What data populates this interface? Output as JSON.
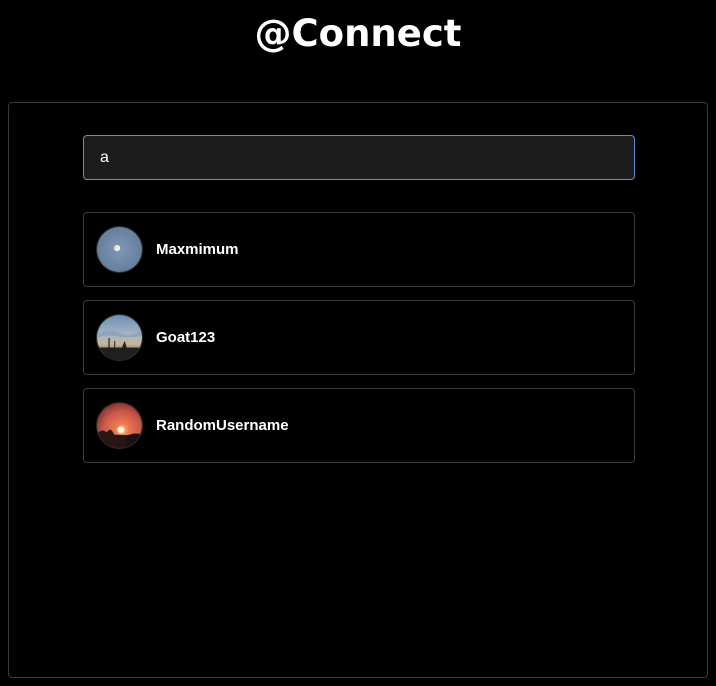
{
  "header": {
    "title": "@Connect"
  },
  "search": {
    "value": "a",
    "placeholder": ""
  },
  "results": [
    {
      "username": "Maxmimum",
      "avatar": "avatar-moon-sky"
    },
    {
      "username": "Goat123",
      "avatar": "avatar-dusk-landscape"
    },
    {
      "username": "RandomUsername",
      "avatar": "avatar-sunset"
    }
  ],
  "colors": {
    "background": "#000000",
    "input_border_focus": "#5b8fd6",
    "card_border": "#3a3a3a",
    "text": "#ffffff"
  }
}
